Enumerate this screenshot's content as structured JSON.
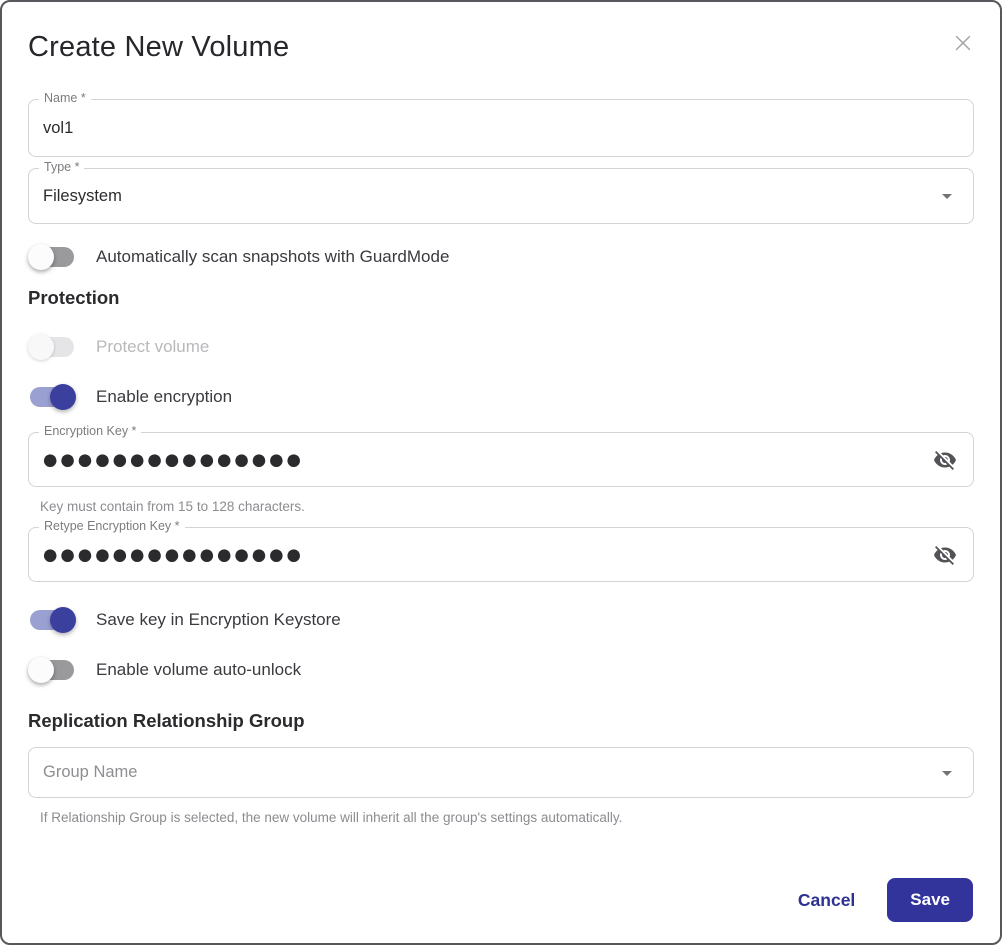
{
  "dialog": {
    "title": "Create New Volume"
  },
  "fields": {
    "name": {
      "label": "Name *",
      "value": "vol1"
    },
    "type": {
      "label": "Type *",
      "value": "Filesystem"
    },
    "encryption_key": {
      "label": "Encryption Key *",
      "value": "●●●●●●●●●●●●●●●",
      "helper": "Key must contain from 15 to 128 characters."
    },
    "retype_encryption_key": {
      "label": "Retype Encryption Key *",
      "value": "●●●●●●●●●●●●●●●"
    },
    "group_name": {
      "placeholder": "Group Name",
      "helper": "If Relationship Group is selected, the new volume will inherit all the group's settings automatically."
    }
  },
  "toggles": {
    "guardmode": {
      "label": "Automatically scan snapshots with GuardMode",
      "state": "off"
    },
    "protect_volume": {
      "label": "Protect volume",
      "state": "disabled-off"
    },
    "enable_encryption": {
      "label": "Enable encryption",
      "state": "on"
    },
    "save_key": {
      "label": "Save key in Encryption Keystore",
      "state": "on"
    },
    "auto_unlock": {
      "label": "Enable volume auto-unlock",
      "state": "off"
    }
  },
  "sections": {
    "protection": "Protection",
    "replication": "Replication Relationship Group"
  },
  "footer": {
    "cancel_label": "Cancel",
    "save_label": "Save"
  },
  "icons": {
    "close": "close-icon",
    "visibility_off": "eye-slash-icon",
    "dropdown": "chevron-down-icon"
  },
  "colors": {
    "accent": "#32349b",
    "cancel_text": "#2d3193",
    "toggle_on_thumb": "#3b3f9e",
    "toggle_on_track": "#9ba0d3",
    "toggle_off_track": "#9a9a9d",
    "field_border": "#d4d4d6"
  }
}
